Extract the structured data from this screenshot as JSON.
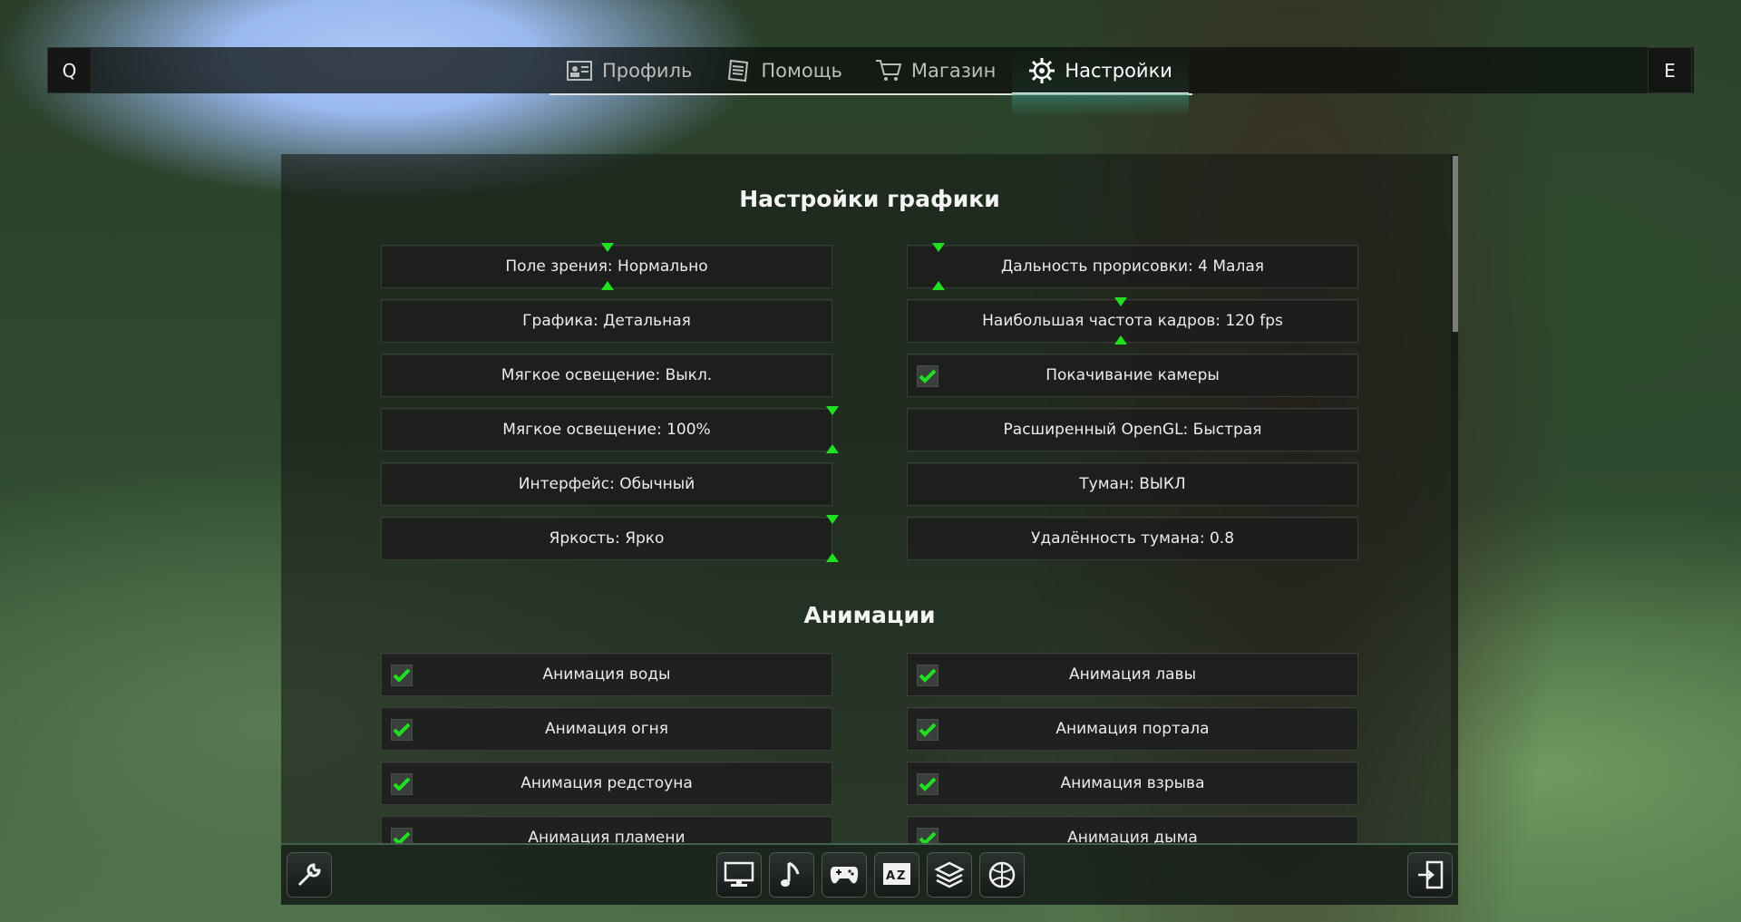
{
  "topbar": {
    "left_key": "Q",
    "right_key": "E",
    "tabs": [
      {
        "label": "Профиль",
        "icon": "profile-card-icon"
      },
      {
        "label": "Помощь",
        "icon": "notebook-icon"
      },
      {
        "label": "Магазин",
        "icon": "shopping-cart-icon"
      },
      {
        "label": "Настройки",
        "icon": "gear-icon",
        "active": true
      }
    ]
  },
  "graphics": {
    "title": "Настройки графики",
    "left": [
      "Поле зрения: Нормально",
      "Графика: Детальная",
      "Мягкое освещение: Выкл.",
      "Мягкое освещение: 100%",
      "Интерфейс: Обычный",
      "Яркость: Ярко"
    ],
    "right": [
      "Дальность прорисовки: 4 Малая",
      "Наибольшая частота кадров: 120 fps",
      "Покачивание камеры",
      "Расширенный OpenGL: Быстрая",
      "Туман: ВЫКЛ",
      "Удалённость тумана: 0.8"
    ]
  },
  "animations": {
    "title": "Анимации",
    "left": [
      "Анимация воды",
      "Анимация огня",
      "Анимация редстоуна",
      "Анимация пламени"
    ],
    "right": [
      "Анимация лавы",
      "Анимация портала",
      "Анимация взрыва",
      "Анимация дыма"
    ]
  },
  "colors": {
    "check_green": "#21e021",
    "accent_teal": "#3c9682"
  },
  "bottom_icons": [
    "wrench-icon",
    "monitor-icon",
    "music-note-icon",
    "gamepad-icon",
    "language-icon",
    "layers-icon",
    "ball-icon",
    "exit-door-icon"
  ]
}
